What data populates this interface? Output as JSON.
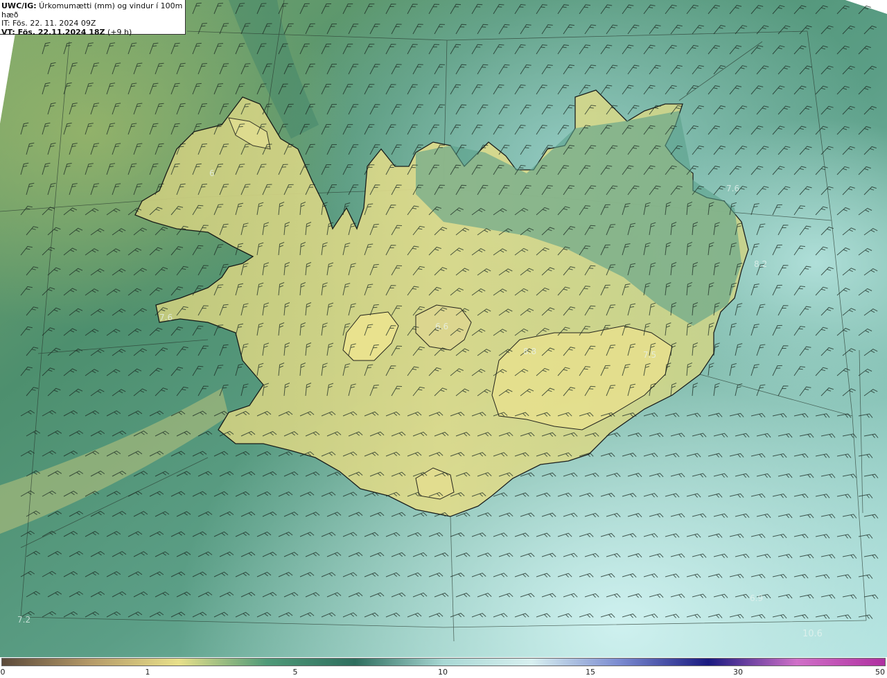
{
  "info": {
    "title_bold": "UWC/IG:",
    "title_rest": " Úrkomumætti (mm) og vindur í 100m hæð",
    "init_time": "IT: Fös. 22. 11. 2024 09Z",
    "valid_bold": "VT: Fös. 22.11.2024 18Z",
    "valid_rest": " (+9 h)"
  },
  "map_labels": {
    "west_fjords": "6",
    "snaefellsnes": "7.6",
    "central": "6.6",
    "vatnajokull": "8.8",
    "east": "7.5",
    "northeast": "7.6",
    "east_sea": "8.2",
    "southeast_sea": "6.9",
    "south_sea": "10.6",
    "southwest_sea": "7.2"
  },
  "colorbar": {
    "ticks": [
      "0",
      "1",
      "5",
      "10",
      "15",
      "30",
      "50"
    ],
    "stops": [
      "#5c4a3a",
      "#b59a68",
      "#e8e08a",
      "#4f9a78",
      "#2e6e5e",
      "#a8d8d4",
      "#d8f0f0",
      "#7a8ad0",
      "#1a1a80",
      "#d070c8",
      "#b030a0"
    ]
  },
  "legend_colors": {
    "low": "#e3dd8c",
    "mid": "#4c9876",
    "high": "#bfe6e3"
  }
}
